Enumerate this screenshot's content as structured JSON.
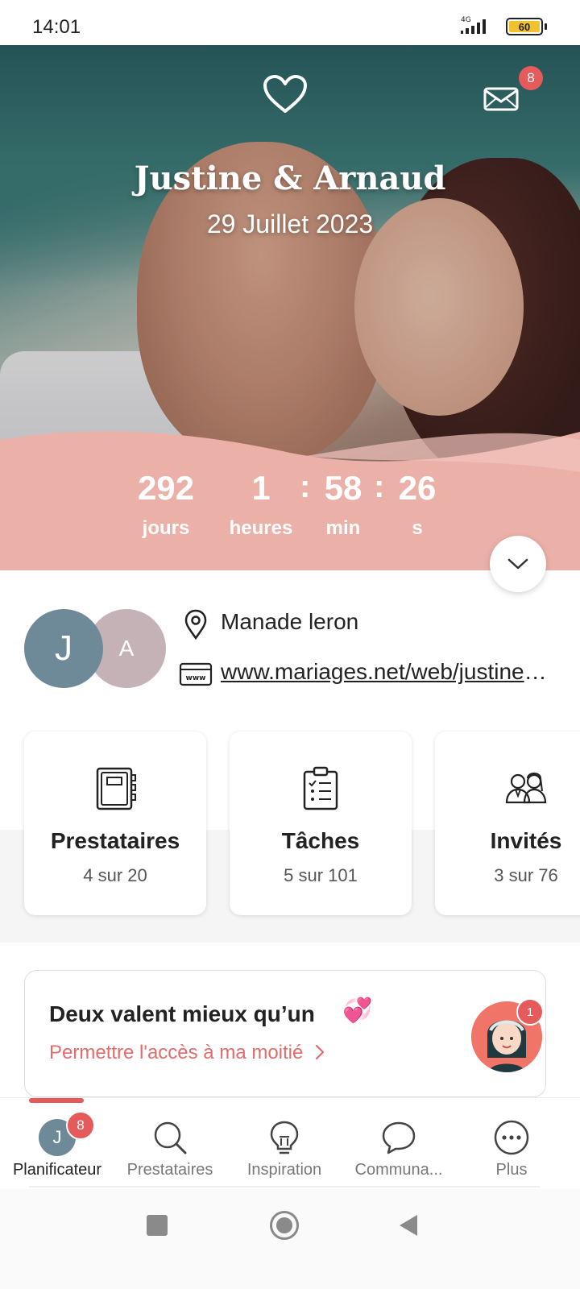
{
  "status_bar": {
    "time": "14:01",
    "network": "4G",
    "battery": "60"
  },
  "hero": {
    "names": "Justine & Arnaud",
    "date": "29 Juillet 2023",
    "messages_badge": "8",
    "countdown": {
      "days": "292",
      "days_label": "jours",
      "hours": "1",
      "hours_label": "heures",
      "minutes": "58",
      "minutes_label": "min",
      "seconds": "26",
      "seconds_label": "s",
      "separator": ":"
    },
    "colors": {
      "countdown_bg": "#ebb1a9",
      "badge": "#e55a5a"
    }
  },
  "couple": {
    "avatar_1": "J",
    "avatar_2": "A",
    "location": "Manade leron",
    "website": "www.mariages.net/web/justine-et-arnaud"
  },
  "cards": [
    {
      "title": "Prestataires",
      "subtitle": "4 sur 20",
      "icon": "notebook-icon"
    },
    {
      "title": "Tâches",
      "subtitle": "5 sur 101",
      "icon": "clipboard-checklist-icon"
    },
    {
      "title": "Invités",
      "subtitle": "3 sur 76",
      "icon": "guests-couple-icon"
    }
  ],
  "partner_banner": {
    "title": "Deux valent mieux qu’un",
    "emoji": "💞",
    "link": "Permettre l'accès à ma moitié",
    "badge": "1"
  },
  "bottom_nav": {
    "items": [
      {
        "label": "Planificateur",
        "avatar": "J",
        "badge": "8",
        "active": true
      },
      {
        "label": "Prestataires",
        "icon": "search-icon"
      },
      {
        "label": "Inspiration",
        "icon": "lightbulb-icon"
      },
      {
        "label": "Communa...",
        "icon": "chat-bubble-icon"
      },
      {
        "label": "Plus",
        "icon": "more-dots-icon"
      }
    ]
  }
}
